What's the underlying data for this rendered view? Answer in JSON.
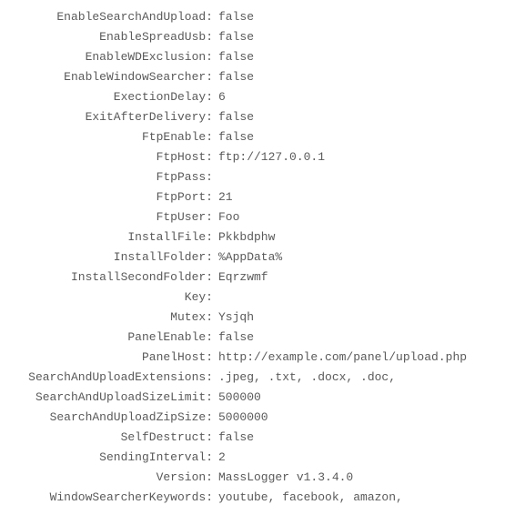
{
  "config": [
    {
      "key": "EnableSearchAndUpload:",
      "value": "false"
    },
    {
      "key": "EnableSpreadUsb:",
      "value": "false"
    },
    {
      "key": "EnableWDExclusion:",
      "value": "false"
    },
    {
      "key": "EnableWindowSearcher:",
      "value": "false"
    },
    {
      "key": "ExectionDelay:",
      "value": "6"
    },
    {
      "key": "ExitAfterDelivery:",
      "value": "false"
    },
    {
      "key": "FtpEnable:",
      "value": "false"
    },
    {
      "key": "FtpHost:",
      "value": "ftp://127.0.0.1"
    },
    {
      "key": "FtpPass:",
      "value": ""
    },
    {
      "key": "FtpPort:",
      "value": "21"
    },
    {
      "key": "FtpUser:",
      "value": "Foo"
    },
    {
      "key": "InstallFile:",
      "value": "Pkkbdphw"
    },
    {
      "key": "InstallFolder:",
      "value": "%AppData%"
    },
    {
      "key": "InstallSecondFolder:",
      "value": "Eqrzwmf"
    },
    {
      "key": "Key:",
      "value": ""
    },
    {
      "key": "Mutex:",
      "value": "Ysjqh"
    },
    {
      "key": "PanelEnable:",
      "value": "false"
    },
    {
      "key": "PanelHost:",
      "value": "http://example.com/panel/upload.php"
    },
    {
      "key": "SearchAndUploadExtensions:",
      "value": ".jpeg, .txt, .docx, .doc,"
    },
    {
      "key": "SearchAndUploadSizeLimit:",
      "value": "500000"
    },
    {
      "key": "SearchAndUploadZipSize:",
      "value": "5000000"
    },
    {
      "key": "SelfDestruct:",
      "value": "false"
    },
    {
      "key": "SendingInterval:",
      "value": "2"
    },
    {
      "key": "Version:",
      "value": "MassLogger v1.3.4.0"
    },
    {
      "key": "WindowSearcherKeywords:",
      "value": "youtube, facebook, amazon,"
    }
  ]
}
